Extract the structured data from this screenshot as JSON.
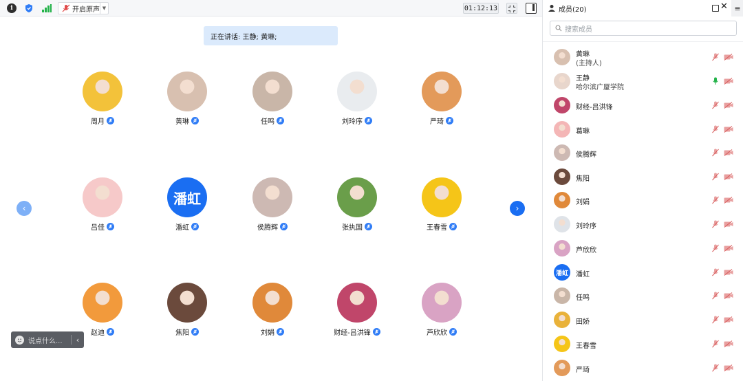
{
  "toolbar": {
    "info_icon": "info-icon",
    "shield_icon": "shield-icon",
    "signal_icon": "signal-bars-icon",
    "original_sound_label": "开启原声",
    "timer": "01:12:13",
    "colors": {
      "accent": "#2f7cf6",
      "signal": "#24b34a",
      "shield": "#2f7cf6"
    }
  },
  "main": {
    "speaking_label": "正在讲话: 王静; 黄琳;",
    "chat_placeholder": "说点什么...",
    "participants": [
      {
        "name": "周月",
        "avatar": "yellow-hat-child",
        "color": "#f3c23a"
      },
      {
        "name": "黄琳",
        "avatar": "sunglasses-woman",
        "color": "#d8c0b0"
      },
      {
        "name": "任鸣",
        "avatar": "girl-portrait",
        "color": "#c9b6a8"
      },
      {
        "name": "刘玲序",
        "avatar": "ink-painting",
        "color": "#e9ecef"
      },
      {
        "name": "严琦",
        "avatar": "sunset-street",
        "color": "#e39a5a"
      },
      {
        "name": "吕佳",
        "avatar": "cartoon-girl",
        "color": "#f6c9c9"
      },
      {
        "name": "潘虹",
        "avatar": "text-avatar",
        "avatar_text": "潘虹",
        "color": "#1a6ef2"
      },
      {
        "name": "侯腾辉",
        "avatar": "woman-portrait",
        "color": "#cdb9b3"
      },
      {
        "name": "张执国",
        "avatar": "grassland",
        "color": "#6a9e4a"
      },
      {
        "name": "王春雪",
        "avatar": "giraffe-cartoon",
        "color": "#f5c518"
      },
      {
        "name": "赵迪",
        "avatar": "cartoon-duck",
        "color": "#f29a3c"
      },
      {
        "name": "焦阳",
        "avatar": "man-portrait",
        "color": "#6b4a3c"
      },
      {
        "name": "刘娟",
        "avatar": "playground-child",
        "color": "#e0893a"
      },
      {
        "name": "财经-吕洪锋",
        "avatar": "anime-girl",
        "color": "#c0466a"
      },
      {
        "name": "芦欣欣",
        "avatar": "baby-face",
        "color": "#d9a3c4"
      }
    ]
  },
  "side": {
    "title": "成员(20)",
    "search_placeholder": "搜索成员",
    "members": [
      {
        "name": "黄琳",
        "sub": "(主持人)",
        "color": "#d8c0b0",
        "speaking": false
      },
      {
        "name": "王静",
        "sub": "哈尔滨广厦学院",
        "color": "#e8d6cc",
        "speaking": true
      },
      {
        "name": "财经-吕洪锋",
        "sub": "",
        "color": "#c0466a",
        "speaking": false
      },
      {
        "name": "葛琳",
        "sub": "",
        "color": "#f4b6b6",
        "speaking": false
      },
      {
        "name": "侯腾辉",
        "sub": "",
        "color": "#cdb9b3",
        "speaking": false
      },
      {
        "name": "焦阳",
        "sub": "",
        "color": "#6b4a3c",
        "speaking": false
      },
      {
        "name": "刘娟",
        "sub": "",
        "color": "#e0893a",
        "speaking": false
      },
      {
        "name": "刘玲序",
        "sub": "",
        "color": "#dfe3e8",
        "speaking": false
      },
      {
        "name": "芦欣欣",
        "sub": "",
        "color": "#d9a3c4",
        "speaking": false
      },
      {
        "name": "潘虹",
        "sub": "",
        "avatar_text": "潘虹",
        "color": "#1a6ef2",
        "speaking": false
      },
      {
        "name": "任鸣",
        "sub": "",
        "color": "#c9b6a8",
        "speaking": false
      },
      {
        "name": "田娇",
        "sub": "",
        "color": "#e9b23a",
        "speaking": false
      },
      {
        "name": "王春雪",
        "sub": "",
        "color": "#f5c518",
        "speaking": false
      },
      {
        "name": "严琦",
        "sub": "",
        "color": "#e39a5a",
        "speaking": false
      }
    ]
  }
}
